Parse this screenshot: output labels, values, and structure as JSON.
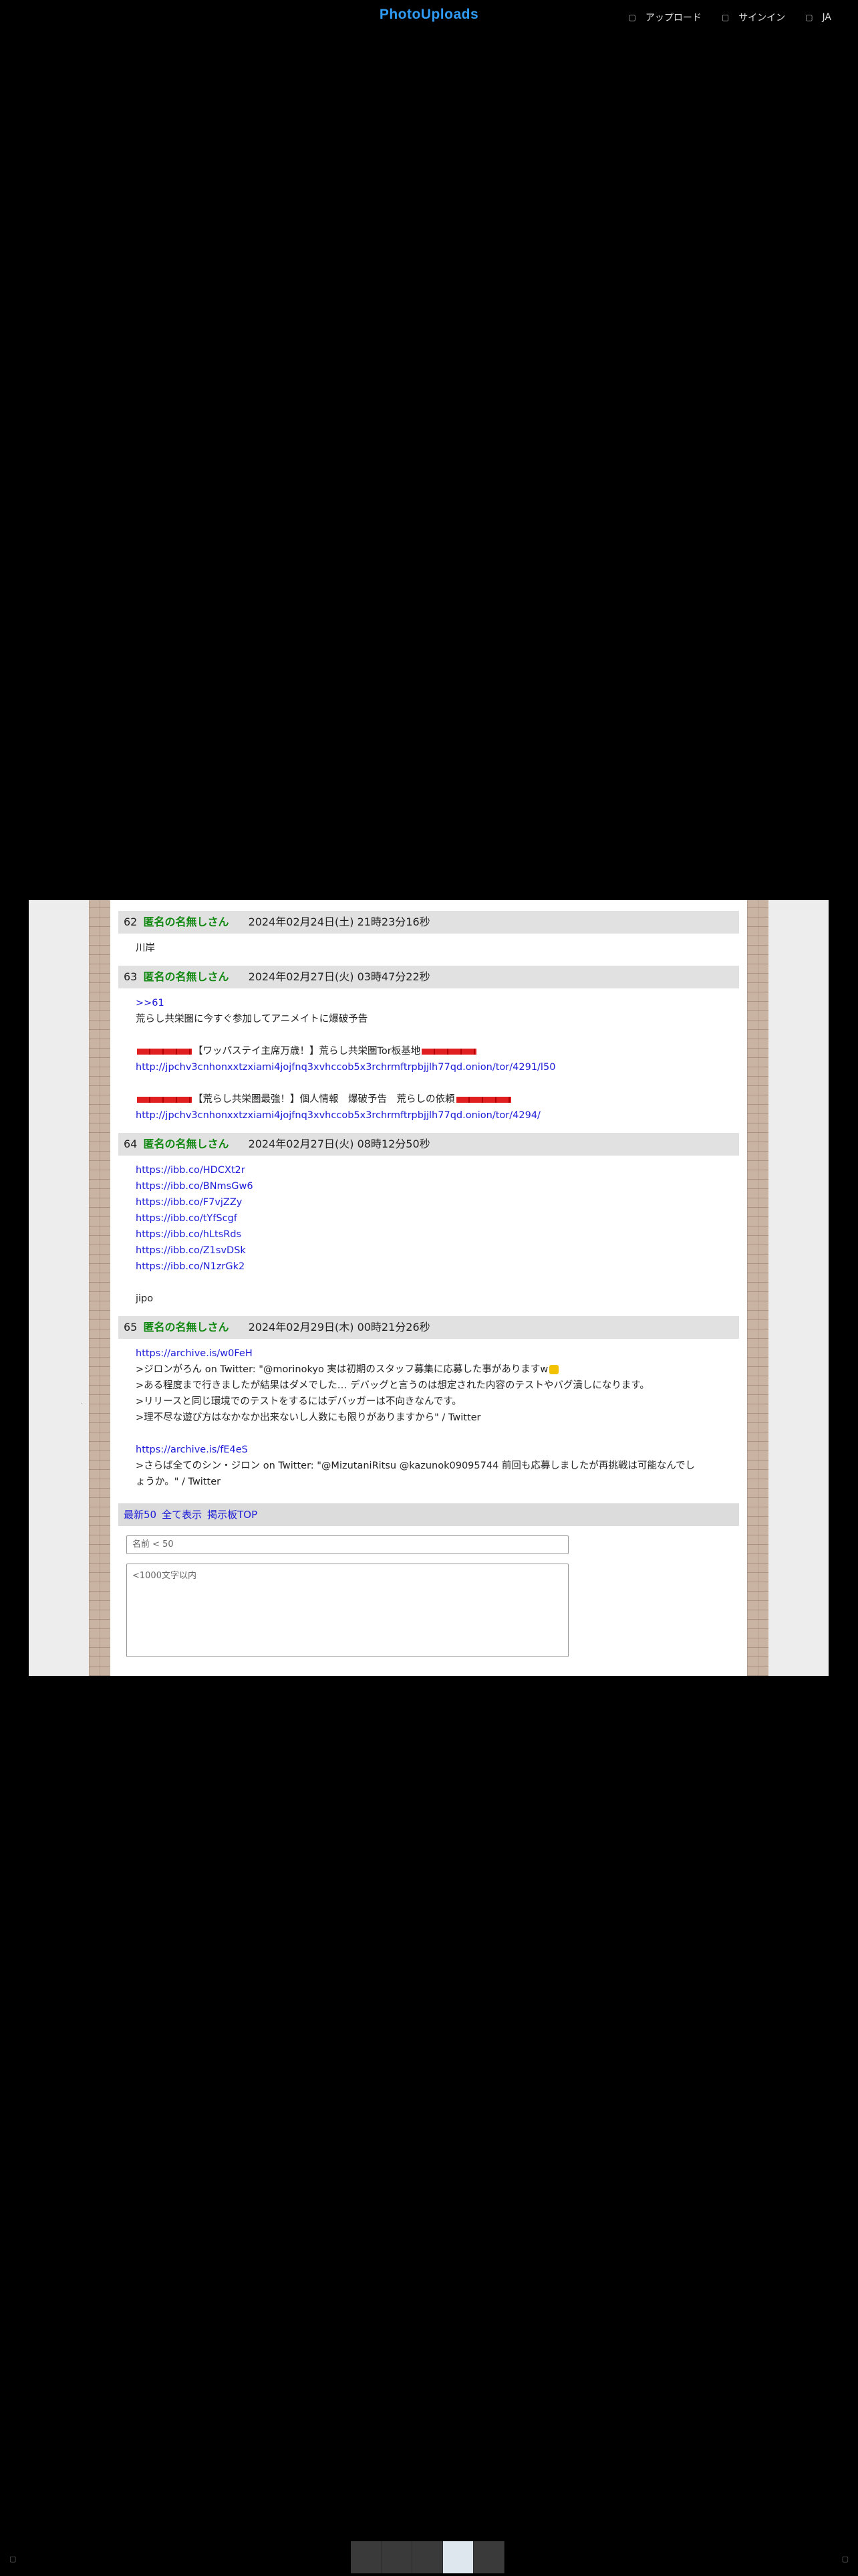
{
  "site": {
    "logo": "PhotoUploads",
    "nav": [
      {
        "icon": "upload-icon",
        "label": "アップロード"
      },
      {
        "icon": "signin-icon",
        "label": "サインイン"
      },
      {
        "icon": "globe-icon",
        "label": "JA"
      }
    ]
  },
  "posts": [
    {
      "num": "62",
      "name": "匿名の名無しさん",
      "date": "2024年02月24日(土) 21時23分16秒",
      "body": "川岸"
    },
    {
      "num": "63",
      "name": "匿名の名無しさん",
      "date": "2024年02月27日(火) 03時47分22秒",
      "reply": ">>61",
      "line1": "荒らし共栄圏に今すぐ参加してアニメイトに爆破予告",
      "line2_text": "【ワッパステイ主席万歳！】荒らし共栄圏Tor板基地",
      "line2_url": "http://jpchv3cnhonxxtzxiami4jojfnq3xvhccob5x3rchrmftrpbjjlh77qd.onion/tor/4291/l50",
      "line3_text": "【荒らし共栄圏最強！】個人情報　爆破予告　荒らしの依頼",
      "line3_url": "http://jpchv3cnhonxxtzxiami4jojfnq3xvhccob5x3rchrmftrpbjjlh77qd.onion/tor/4294/"
    },
    {
      "num": "64",
      "name": "匿名の名無しさん",
      "date": "2024年02月27日(火) 08時12分50秒",
      "links": [
        "https://ibb.co/HDCXt2r",
        "https://ibb.co/BNmsGw6",
        "https://ibb.co/F7vjZZy",
        "https://ibb.co/tYfScgf",
        "https://ibb.co/hLtsRds",
        "https://ibb.co/Z1svDSk",
        "https://ibb.co/N1zrGk2"
      ],
      "tail": "jipo"
    },
    {
      "num": "65",
      "name": "匿名の名無しさん",
      "date": "2024年02月29日(木) 00時21分26秒",
      "link1": "https://archive.is/w0FeH",
      "l1": ">ジロンがろん on Twitter: \"@morinokyo 実は初期のスタッフ募集に応募した事がありますw",
      "l2": ">ある程度まで行きましたが結果はダメでした… デバッグと言うのは想定された内容のテストやバグ潰しになります。",
      "l3": ">リリースと同じ環境でのテストをするにはデバッガーは不向きなんです。",
      "l4": ">理不尽な遊び方はなかなか出来ないし人数にも限りがありますから\" / Twitter",
      "link2": "https://archive.is/fE4eS",
      "l5": ">さらば全てのシン・ジロン on Twitter: \"@MizutaniRitsu @kazunok09095744 前回も応募しましたが再挑戦は可能なんでし",
      "l6": "ょうか。\" / Twitter"
    }
  ],
  "board_nav": [
    "最新50",
    "全て表示",
    "掲示板TOP"
  ],
  "form": {
    "name_placeholder": "名前 < 50",
    "message_placeholder": "<1000文字以内"
  },
  "colors": {
    "logo": "#2f9bf4",
    "name": "#118811",
    "link": "#1c1cd8"
  }
}
